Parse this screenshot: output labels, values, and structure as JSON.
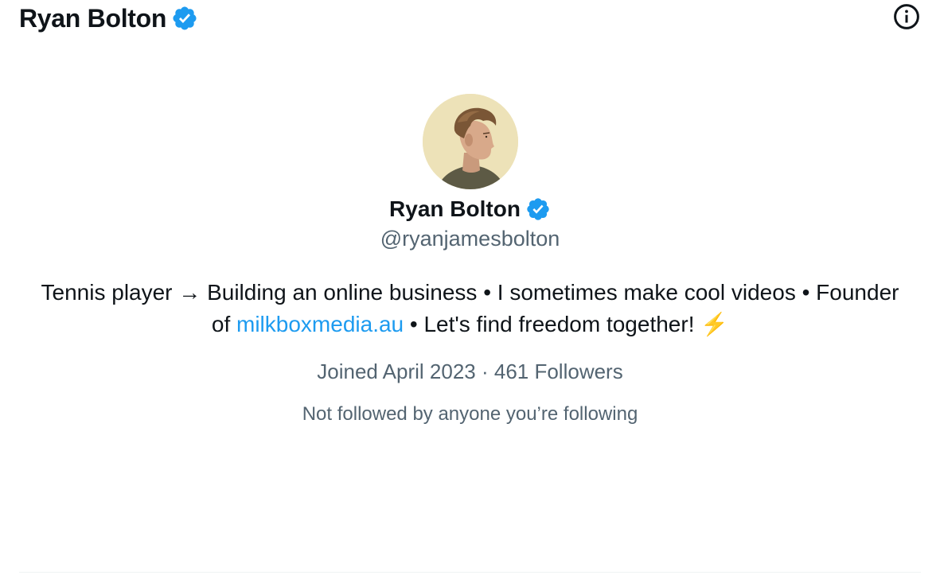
{
  "header": {
    "title": "Ryan Bolton",
    "verified_icon": "verified-badge-icon",
    "info_icon": "info-icon"
  },
  "profile": {
    "name": "Ryan Bolton",
    "handle": "@ryanjamesbolton",
    "bio_part1": "Tennis player → Building an online business • I sometimes make cool videos • Founder of ",
    "bio_link": "milkboxmedia.au",
    "bio_part2": " • Let's find freedom together! ⚡️",
    "joined": "Joined April 2023",
    "separator": " · ",
    "followers": "461 Followers",
    "mutuals": "Not followed by anyone you’re following"
  },
  "colors": {
    "verified": "#1d9bf0",
    "link": "#1d9bf0",
    "secondary_text": "#536471",
    "avatar_bg": "#ede2b8"
  }
}
